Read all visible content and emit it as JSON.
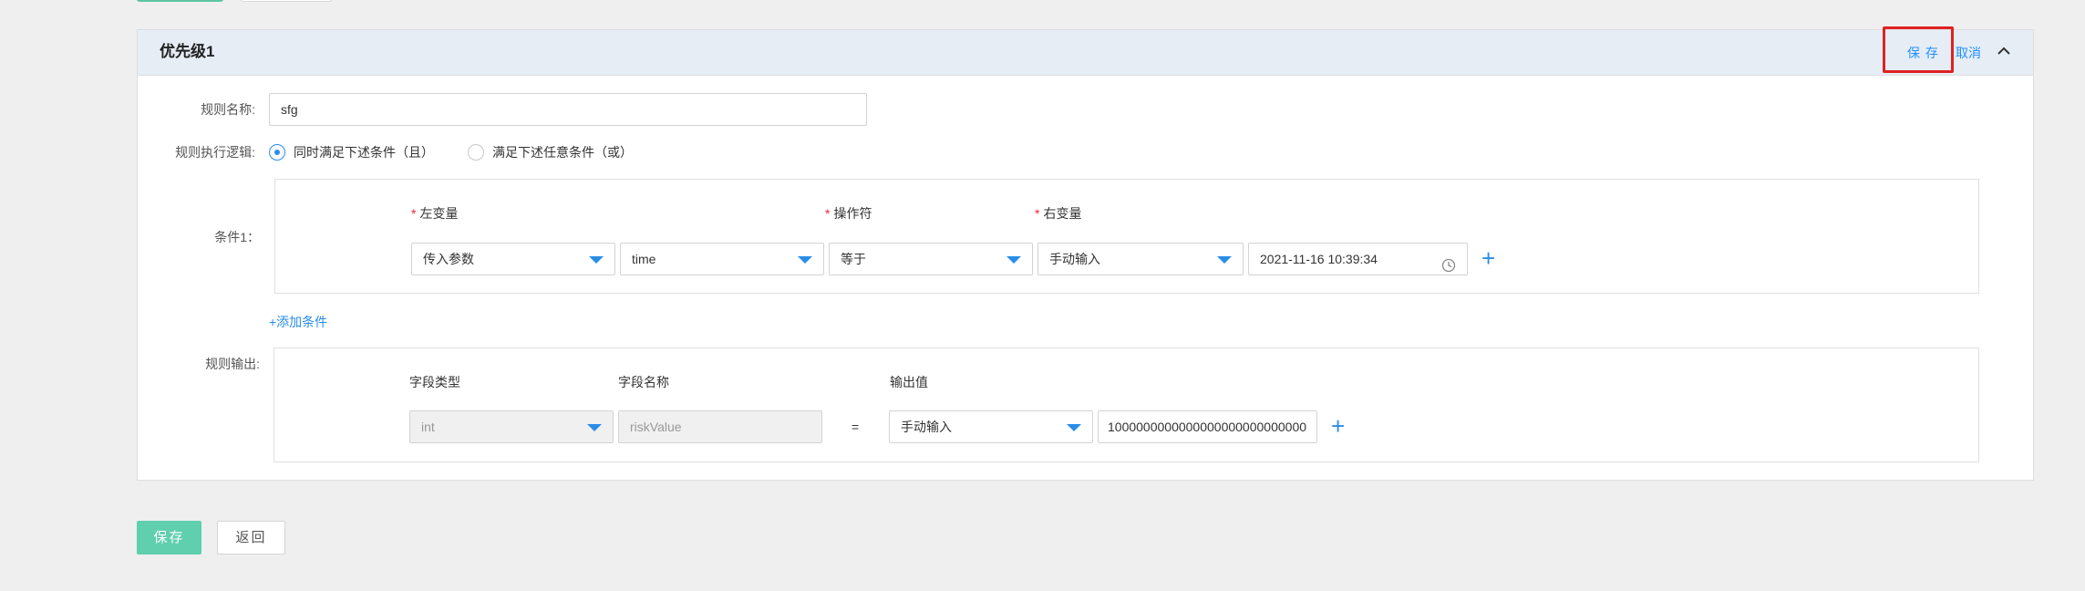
{
  "rule": {
    "title": "优先级1",
    "header_save": "保 存",
    "header_cancel": "取消",
    "name_label": "规则名称:",
    "name_value": "sfg",
    "logic_label": "规则执行逻辑:",
    "logic_options": [
      "同时满足下述条件（且）",
      "满足下述任意条件（或）"
    ],
    "logic_selected": 0,
    "condition_label": "条件1：",
    "condition_headers": {
      "left": "左变量",
      "op": "操作符",
      "right": "右变量"
    },
    "condition": {
      "left_type": "传入参数",
      "left_var": "time",
      "operator": "等于",
      "right_type": "手动输入",
      "right_value": "2021-11-16 10:39:34"
    },
    "add_condition": "+添加条件",
    "output_label": "规则输出:",
    "output_headers": {
      "field_type": "字段类型",
      "field_name": "字段名称",
      "output_value": "输出值"
    },
    "output": {
      "field_type": "int",
      "field_name": "riskValue",
      "equals": "=",
      "value_type": "手动输入",
      "value": "1000000000000000000000000000"
    }
  },
  "footer": {
    "save": "保存",
    "back": "返回"
  },
  "colors": {
    "accent": "#2a8de8",
    "primary_button": "#5fcfad",
    "highlight": "#e02020",
    "header_bg": "#e6edf5"
  },
  "icons": [
    "clock-icon",
    "chevron-up-icon",
    "plus-icon",
    "caret-down-icon"
  ]
}
